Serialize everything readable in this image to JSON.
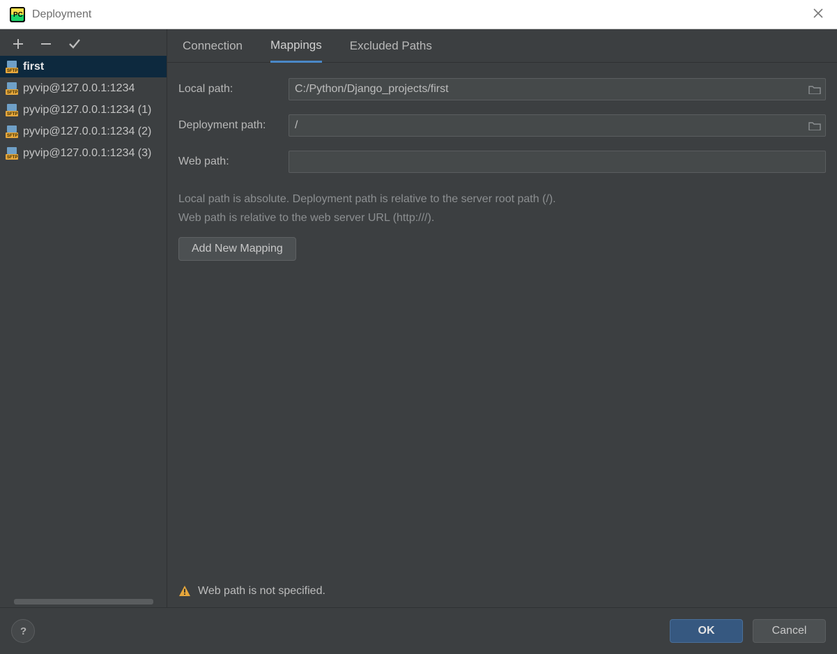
{
  "window": {
    "title": "Deployment"
  },
  "sidebar": {
    "items": [
      {
        "label": "first"
      },
      {
        "label": "pyvip@127.0.0.1:1234"
      },
      {
        "label": "pyvip@127.0.0.1:1234 (1)"
      },
      {
        "label": "pyvip@127.0.0.1:1234 (2)"
      },
      {
        "label": "pyvip@127.0.0.1:1234 (3)"
      }
    ]
  },
  "tabs": {
    "connection": "Connection",
    "mappings": "Mappings",
    "excluded": "Excluded Paths"
  },
  "form": {
    "local_path_label": "Local path:",
    "local_path_value": "C:/Python/Django_projects/first",
    "deployment_path_label": "Deployment path:",
    "deployment_path_value": "/",
    "web_path_label": "Web path:",
    "web_path_value": "",
    "help_line1": "Local path is absolute. Deployment path is relative to the server root path (/).",
    "help_line2": "Web path is relative to the web server URL (http:///).",
    "add_mapping_label": "Add New Mapping"
  },
  "warning": {
    "text": "Web path is not specified."
  },
  "footer": {
    "ok": "OK",
    "cancel": "Cancel"
  }
}
